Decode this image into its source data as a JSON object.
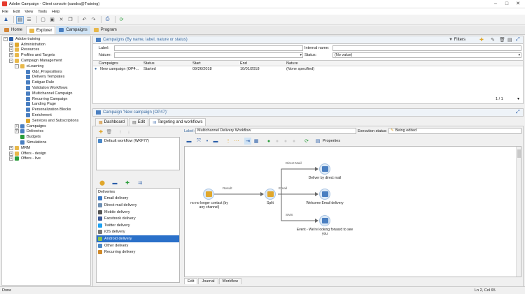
{
  "window": {
    "title": "Adobe Campaign - Client console (sandra@Training)"
  },
  "menu": [
    "File",
    "Edit",
    "View",
    "Tools",
    "Help"
  ],
  "nav_tabs": [
    {
      "label": "Home"
    },
    {
      "label": "Explorer"
    },
    {
      "label": "Campaigns"
    },
    {
      "label": "Program"
    }
  ],
  "tree": [
    {
      "label": "Adobe training",
      "depth": 0,
      "exp": "−"
    },
    {
      "label": "Administration",
      "depth": 1,
      "exp": "+"
    },
    {
      "label": "Resources",
      "depth": 1,
      "exp": "+"
    },
    {
      "label": "Profiles and Targets",
      "depth": 1,
      "exp": "+"
    },
    {
      "label": "Campaign Management",
      "depth": 1,
      "exp": "−"
    },
    {
      "label": "eLearning",
      "depth": 2,
      "exp": "−"
    },
    {
      "label": "O&I_Propositions",
      "depth": 3,
      "exp": ""
    },
    {
      "label": "Delivery Templates",
      "depth": 3,
      "exp": ""
    },
    {
      "label": "Fatigue Rule",
      "depth": 3,
      "exp": ""
    },
    {
      "label": "Validation Workflows",
      "depth": 3,
      "exp": ""
    },
    {
      "label": "Multichannel Campaign",
      "depth": 3,
      "exp": ""
    },
    {
      "label": "Recurring Campaign",
      "depth": 3,
      "exp": ""
    },
    {
      "label": "Landing Page",
      "depth": 3,
      "exp": ""
    },
    {
      "label": "Personalization Blocks",
      "depth": 3,
      "exp": ""
    },
    {
      "label": "Enrichment",
      "depth": 3,
      "exp": ""
    },
    {
      "label": "Services and Subscriptions",
      "depth": 3,
      "exp": ""
    },
    {
      "label": "Campaigns",
      "depth": 2,
      "exp": "+"
    },
    {
      "label": "Deliveries",
      "depth": 2,
      "exp": "+"
    },
    {
      "label": "Budgets",
      "depth": 2,
      "exp": ""
    },
    {
      "label": "Simulations",
      "depth": 2,
      "exp": ""
    },
    {
      "label": "MRM",
      "depth": 1,
      "exp": "+"
    },
    {
      "label": "Offers - design",
      "depth": 1,
      "exp": "+"
    },
    {
      "label": "Offers - live",
      "depth": 1,
      "exp": "+"
    }
  ],
  "campaigns_panel": {
    "title": "Campaigns (By name, label, nature or status)",
    "filters_label": "Filters",
    "label_field_label": "Label:",
    "label_field_value": "",
    "internal_name_label": "Internal name:",
    "internal_name_value": "",
    "nature_label": "Nature:",
    "nature_value": "",
    "status_label": "Status:",
    "status_value": "(No value)",
    "columns": [
      "Campaigns",
      "Status",
      "Start",
      "End",
      "Nature"
    ],
    "rows": [
      {
        "campaign": "New campaign (OP4...",
        "status": "Started",
        "start": "09/26/2018",
        "end": "10/01/2018",
        "nature": "(None specified)"
      }
    ],
    "pager": "1 / 1"
  },
  "campaign_detail": {
    "title": "Campaign 'New campaign (OP47)'",
    "tabs": [
      "Dashboard",
      "Edit",
      "Targeting and workflows"
    ],
    "workflow_list": [
      "Default workflow (WKF77)"
    ],
    "workflow_label_label": "Label:",
    "workflow_label_value": "Multichannel Delivery Workflow",
    "execution_status_label": "Execution status:",
    "execution_status_value": "Being edited",
    "properties_label": "Properties",
    "palette_title": "Deliveries",
    "palette_items": [
      {
        "label": "Email delivery",
        "color": "#3a78c4"
      },
      {
        "label": "Direct mail delivery",
        "color": "#6d8fb3"
      },
      {
        "label": "Mobile delivery",
        "color": "#555"
      },
      {
        "label": "Facebook delivery",
        "color": "#3b5998"
      },
      {
        "label": "Twitter delivery",
        "color": "#1da1f2"
      },
      {
        "label": "iOS delivery",
        "color": "#777"
      },
      {
        "label": "Android delivery",
        "color": "#8bc34a"
      },
      {
        "label": "Other delivery",
        "color": "#4a88c8"
      },
      {
        "label": "Recurring delivery",
        "color": "#d08a2a"
      }
    ],
    "bottom_tabs": [
      "Edit",
      "Journal",
      "Workflow"
    ],
    "nodes": {
      "query": "no no longer contact (by any channel)",
      "split": "Split",
      "direct_mail": "Deliver by direct mail",
      "email": "Welcome Email delivery",
      "sms": "Event - We're looking forward to see you"
    },
    "transitions": {
      "result": "Result",
      "direct_mail": "Direct Mail",
      "email": "Email",
      "sms": "SMS"
    }
  },
  "status_bar": {
    "left": "Done",
    "right": "Ln 2, Col 65"
  }
}
